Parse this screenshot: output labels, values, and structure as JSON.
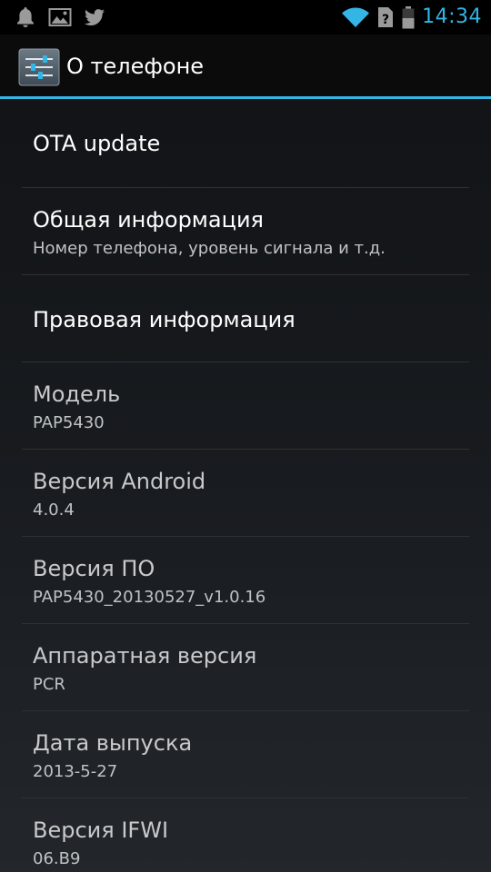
{
  "status_bar": {
    "time": "14:34",
    "time_color": "#33b5e5",
    "left_icons": [
      "notification-bell-icon",
      "gallery-image-icon",
      "twitter-bird-icon"
    ],
    "right_icons": [
      "wifi-icon",
      "no-sim-icon",
      "battery-icon"
    ]
  },
  "action_bar": {
    "title": "О телефоне",
    "icon": "settings-sliders-icon",
    "accent": "#33b5e5"
  },
  "items": [
    {
      "title": "OTA update"
    },
    {
      "title": "Общая информация",
      "summary": "Номер телефона, уровень сигнала и т.д."
    },
    {
      "title": "Правовая информация"
    },
    {
      "title": "Модель",
      "summary": "PAP5430"
    },
    {
      "title": "Версия Android",
      "summary": "4.0.4"
    },
    {
      "title": "Версия ПО",
      "summary": "PAP5430_20130527_v1.0.16"
    },
    {
      "title": "Аппаратная версия",
      "summary": "PCR"
    },
    {
      "title": "Дата выпуска",
      "summary": "2013-5-27"
    },
    {
      "title": "Версия IFWI",
      "summary": "06.B9"
    }
  ]
}
